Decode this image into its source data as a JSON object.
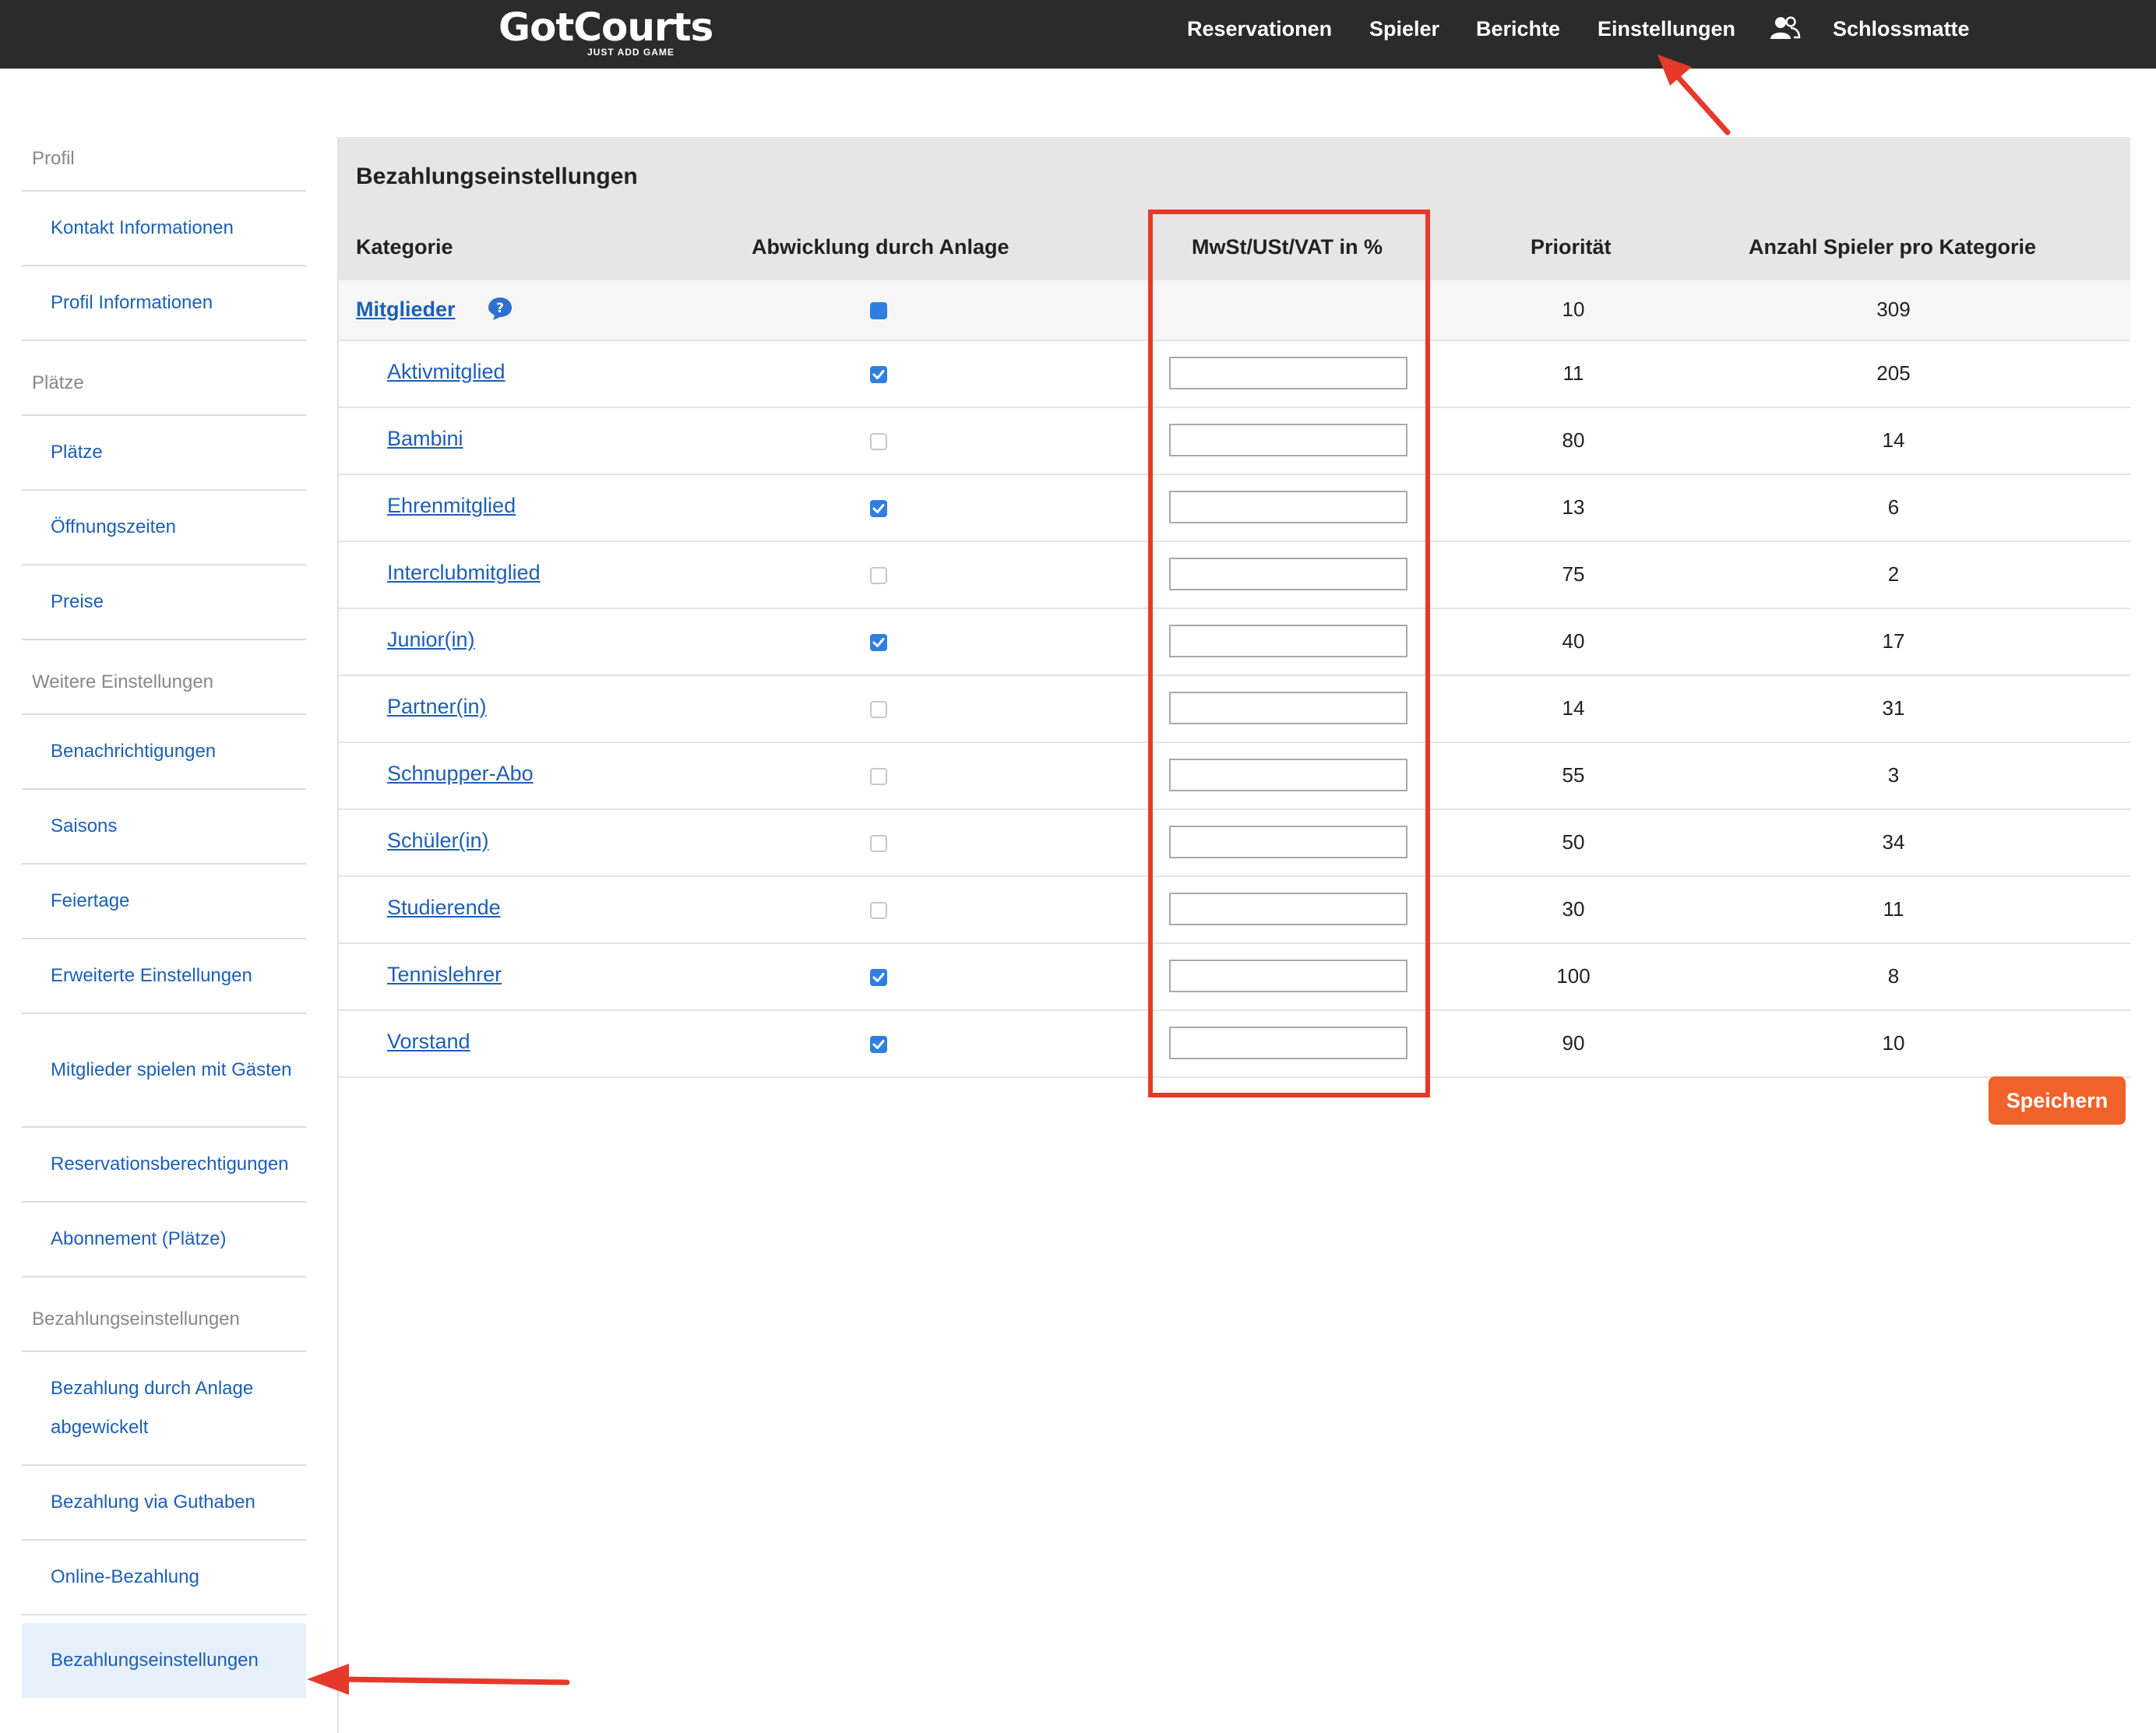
{
  "topbar": {
    "logo": {
      "main": "GotCourts",
      "tagline": "JUST ADD GAME"
    },
    "nav": [
      "Reservationen",
      "Spieler",
      "Berichte",
      "Einstellungen"
    ],
    "user_icon": "users-icon",
    "club_name": "Schlossmatte"
  },
  "sidebar": {
    "sections": [
      {
        "title": "Profil",
        "items": [
          "Kontakt Informationen",
          "Profil Informationen"
        ]
      },
      {
        "title": "Plätze",
        "items": [
          "Plätze",
          "Öffnungszeiten",
          "Preise"
        ]
      },
      {
        "title": "Weitere Einstellungen",
        "items": [
          "Benachrichtigungen",
          "Saisons",
          "Feiertage",
          "Erweiterte Einstellungen",
          "Mitglieder spielen mit Gästen",
          "Reservationsberechtigungen",
          "Abonnement (Plätze)"
        ]
      },
      {
        "title": "Bezahlungseinstellungen",
        "items": [
          "Bezahlung durch Anlage abgewickelt",
          "Bezahlung via Guthaben",
          "Online-Bezahlung",
          "Bezahlungseinstellungen"
        ]
      }
    ],
    "active_item": "Bezahlungseinstellungen"
  },
  "main": {
    "title": "Bezahlungseinstellungen",
    "columns": {
      "category": "Kategorie",
      "handled": "Abwicklung durch Anlage",
      "vat": "MwSt/USt/VAT in %",
      "priority": "Priorität",
      "count": "Anzahl Spieler pro Kategorie"
    },
    "parent": {
      "name": "Mitglieder",
      "handled": true,
      "priority": "10",
      "count": "309",
      "help_icon": "help-bubble-icon"
    },
    "rows": [
      {
        "name": "Aktivmitglied",
        "handled": true,
        "vat": "",
        "priority": "11",
        "count": "205"
      },
      {
        "name": "Bambini",
        "handled": false,
        "vat": "",
        "priority": "80",
        "count": "14"
      },
      {
        "name": "Ehrenmitglied",
        "handled": true,
        "vat": "",
        "priority": "13",
        "count": "6"
      },
      {
        "name": "Interclubmitglied",
        "handled": false,
        "vat": "",
        "priority": "75",
        "count": "2"
      },
      {
        "name": "Junior(in)",
        "handled": true,
        "vat": "",
        "priority": "40",
        "count": "17"
      },
      {
        "name": "Partner(in)",
        "handled": false,
        "vat": "",
        "priority": "14",
        "count": "31"
      },
      {
        "name": "Schnupper-Abo",
        "handled": false,
        "vat": "",
        "priority": "55",
        "count": "3"
      },
      {
        "name": "Schüler(in)",
        "handled": false,
        "vat": "",
        "priority": "50",
        "count": "34"
      },
      {
        "name": "Studierende",
        "handled": false,
        "vat": "",
        "priority": "30",
        "count": "11"
      },
      {
        "name": "Tennislehrer",
        "handled": true,
        "vat": "",
        "priority": "100",
        "count": "8"
      },
      {
        "name": "Vorstand",
        "handled": true,
        "vat": "",
        "priority": "90",
        "count": "10"
      }
    ],
    "save_label": "Speichern"
  },
  "colors": {
    "topbar": "#2b2b2b",
    "link": "#1d5fb4",
    "checkbox": "#2f7fe0",
    "save_button": "#f0622a",
    "annotation": "#e53a2b"
  }
}
